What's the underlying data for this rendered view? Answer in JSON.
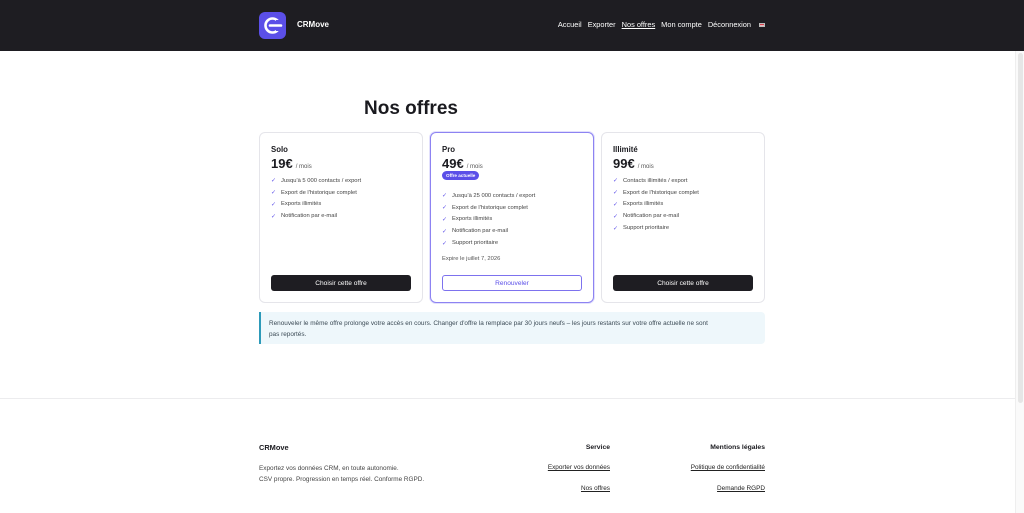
{
  "header": {
    "brand": "CRMove",
    "nav": [
      "Accueil",
      "Exporter",
      "Nos offres",
      "Mon compte",
      "Déconnexion"
    ],
    "active_nav": "Nos offres"
  },
  "page": {
    "title": "Nos offres"
  },
  "plans": [
    {
      "name": "Solo",
      "price": "19€",
      "unit": "/ mois",
      "features": [
        "Jusqu'à 5 000 contacts / export",
        "Export de l'historique complet",
        "Exports illimités",
        "Notification par e-mail"
      ],
      "button": "Choisir cette offre"
    },
    {
      "name": "Pro",
      "price": "49€",
      "unit": "/ mois",
      "badge": "Offre actuelle",
      "features": [
        "Jusqu'à 25 000 contacts / export",
        "Export de l'historique complet",
        "Exports illimités",
        "Notification par e-mail",
        "Support prioritaire"
      ],
      "expires": "Expire le juillet 7, 2026",
      "button": "Renouveler"
    },
    {
      "name": "Illimité",
      "price": "99€",
      "unit": "/ mois",
      "features": [
        "Contacts illimités / export",
        "Export de l'historique complet",
        "Exports illimités",
        "Notification par e-mail",
        "Support prioritaire"
      ],
      "button": "Choisir cette offre"
    }
  ],
  "info": {
    "line1": "Renouveler le même offre prolonge votre accès en cours. Changer d'offre la remplace par 30 jours neufs – les jours restants sur votre offre actuelle ne sont",
    "line2": "pas reportés."
  },
  "footer": {
    "brand": "CRMove",
    "desc1": "Exportez vos données CRM, en toute autonomie.",
    "desc2": "CSV propre. Progression en temps réel. Conforme RGPD.",
    "service_title": "Service",
    "service_links": [
      "Exporter vos données",
      "Nos offres"
    ],
    "legal_title": "Mentions légales",
    "legal_links": [
      "Politique de confidentialité",
      "Demande RGPD"
    ]
  },
  "colors": {
    "accent": "#5b4fe8",
    "header_bg": "#1e1d22",
    "info_border": "#2d9ab9",
    "info_bg": "#eef7fb"
  },
  "icons": {
    "logo": "exit-arrow-icon",
    "language": "uk-flag-icon",
    "feature": "checkmark-icon"
  }
}
